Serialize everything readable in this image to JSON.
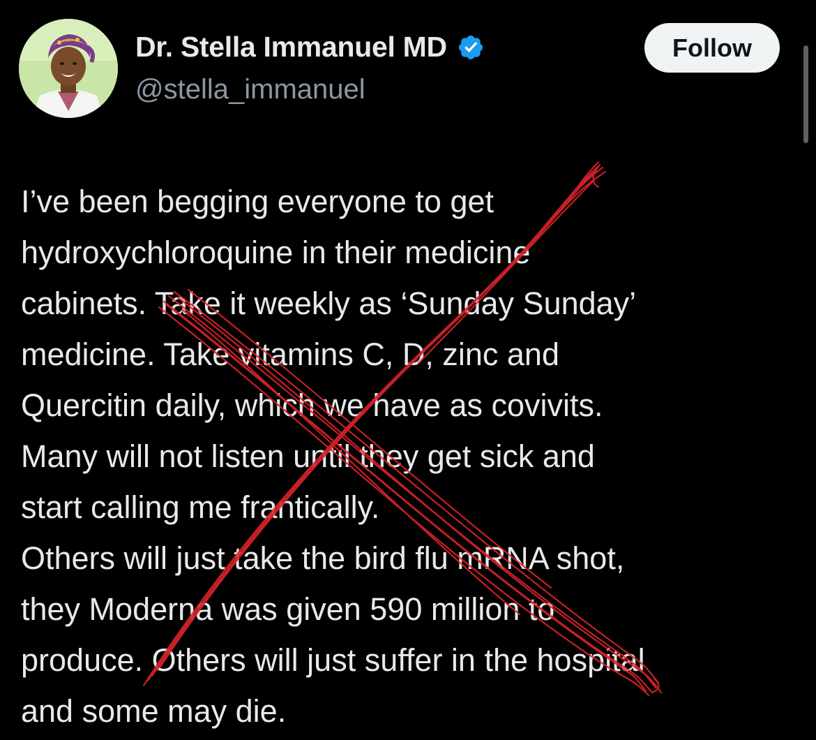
{
  "tweet": {
    "author": {
      "display_name": "Dr. Stella Immanuel MD",
      "handle": "@stella_immanuel",
      "avatar_icon": "profile-photo",
      "verified_icon": "verified-badge-icon"
    },
    "follow_label": "Follow",
    "text_lines": [
      "I’ve been begging everyone to get",
      "hydroxychloroquine in their medicine",
      "cabinets. Take it weekly as ‘Sunday Sunday’",
      "medicine. Take vitamins C, D, zinc and",
      "Quercitin daily, which we have as covivits.",
      "Many will not listen until they get sick and",
      "start calling me frantically.",
      "Others will just take the bird flu mRNA shot,",
      "they Moderna was given 590 million to",
      "produce. Others will just suffer in the hospital",
      "and some may die."
    ],
    "overlay_mark": "red-x-scribble"
  },
  "colors": {
    "background": "#000000",
    "text": "#e7e9ea",
    "handle": "#8b98a5",
    "verified": "#1d9bf0",
    "follow_bg": "#eff3f4",
    "scribble": "#d8232a"
  }
}
